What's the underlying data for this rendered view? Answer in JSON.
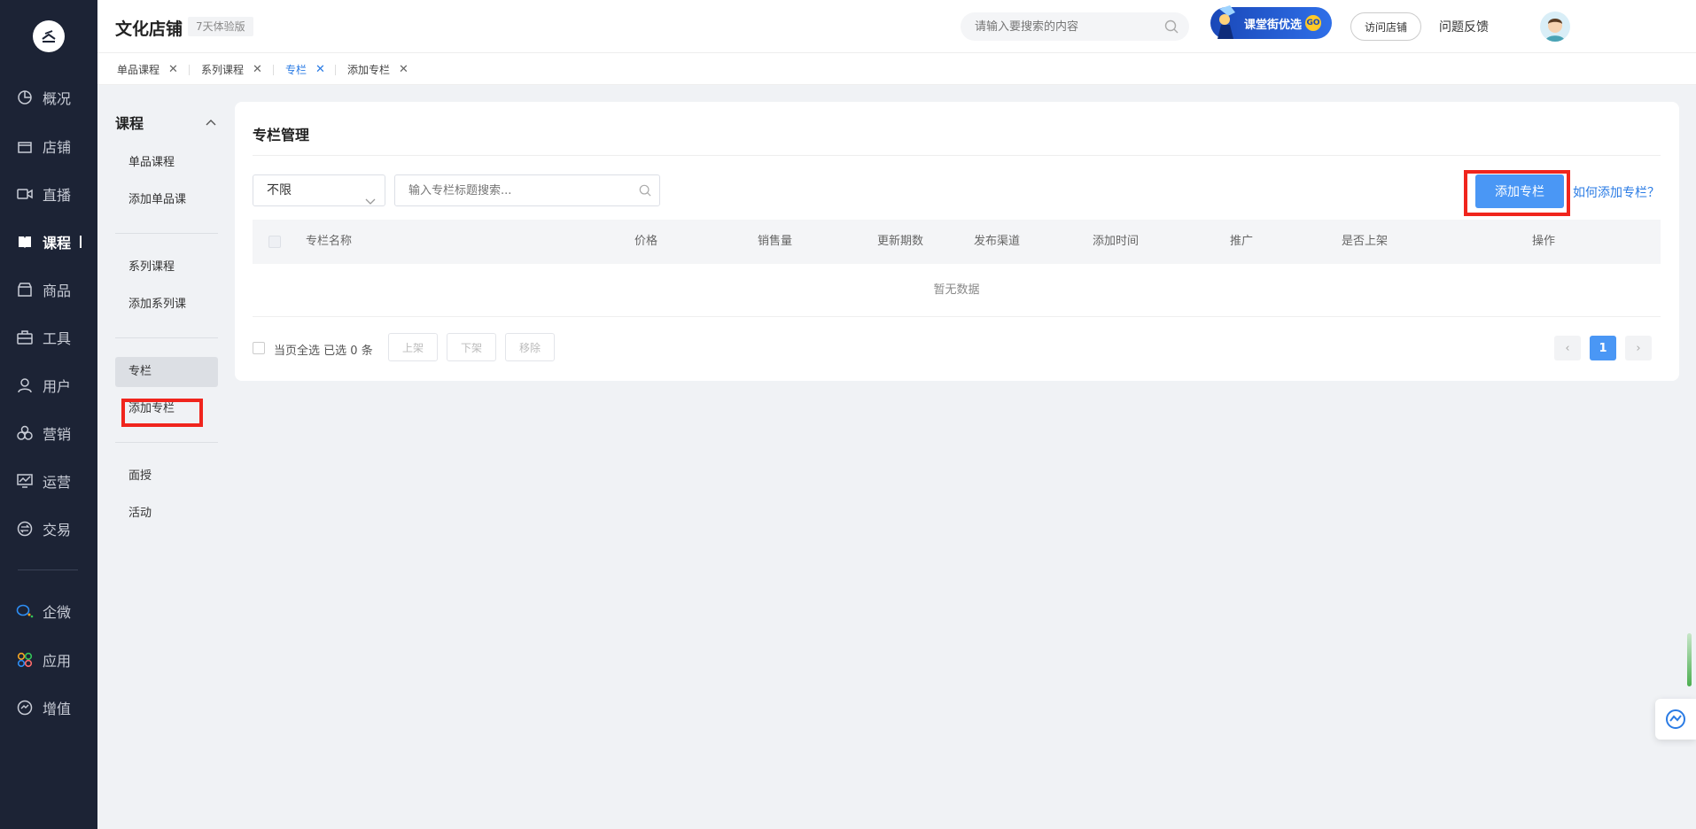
{
  "header": {
    "shop_name": "文化店铺",
    "trial_badge": "7天体验版",
    "search_placeholder": "请输入要搜索的内容",
    "promo_label": "课堂街优选",
    "promo_go": "GO",
    "visit_store": "访问店铺",
    "feedback": "问题反馈"
  },
  "leftnav": {
    "items": [
      {
        "label": "概况",
        "icon": "pie-chart-icon"
      },
      {
        "label": "店铺",
        "icon": "store-icon"
      },
      {
        "label": "直播",
        "icon": "video-camera-icon"
      },
      {
        "label": "课程",
        "icon": "book-icon",
        "active": true
      },
      {
        "label": "商品",
        "icon": "shop-icon"
      },
      {
        "label": "工具",
        "icon": "toolbox-icon"
      },
      {
        "label": "用户",
        "icon": "user-icon"
      },
      {
        "label": "营销",
        "icon": "marketing-icon"
      },
      {
        "label": "运营",
        "icon": "monitor-chart-icon"
      },
      {
        "label": "交易",
        "icon": "exchange-icon"
      },
      {
        "label": "企微",
        "icon": "wecom-icon"
      },
      {
        "label": "应用",
        "icon": "apps-icon"
      },
      {
        "label": "增值",
        "icon": "value-added-icon"
      }
    ]
  },
  "tabs": [
    {
      "label": "单品课程"
    },
    {
      "label": "系列课程"
    },
    {
      "label": "专栏",
      "active": true
    },
    {
      "label": "添加专栏"
    }
  ],
  "subnav": {
    "title": "课程",
    "groups": [
      [
        "单品课程",
        "添加单品课"
      ],
      [
        "系列课程",
        "添加系列课"
      ],
      [
        "专栏",
        "添加专栏"
      ],
      [
        "面授",
        "活动"
      ]
    ]
  },
  "main": {
    "title": "专栏管理",
    "filter_value": "不限",
    "search_placeholder": "输入专栏标题搜索...",
    "add_button": "添加专栏",
    "help_link": "如何添加专栏？",
    "columns": [
      "专栏名称",
      "价格",
      "销售量",
      "更新期数",
      "发布渠道",
      "添加时间",
      "推广",
      "是否上架",
      "操作"
    ],
    "empty_text": "暂无数据",
    "select_all": "当页全选",
    "selected_text": "已选 0 条",
    "bulk_actions": [
      "上架",
      "下架",
      "移除"
    ],
    "current_page": "1"
  },
  "colors": {
    "nav_bg": "#1c2335",
    "primary": "#4a97f5",
    "link": "#2a7be4",
    "highlight_box": "#f0251d"
  }
}
